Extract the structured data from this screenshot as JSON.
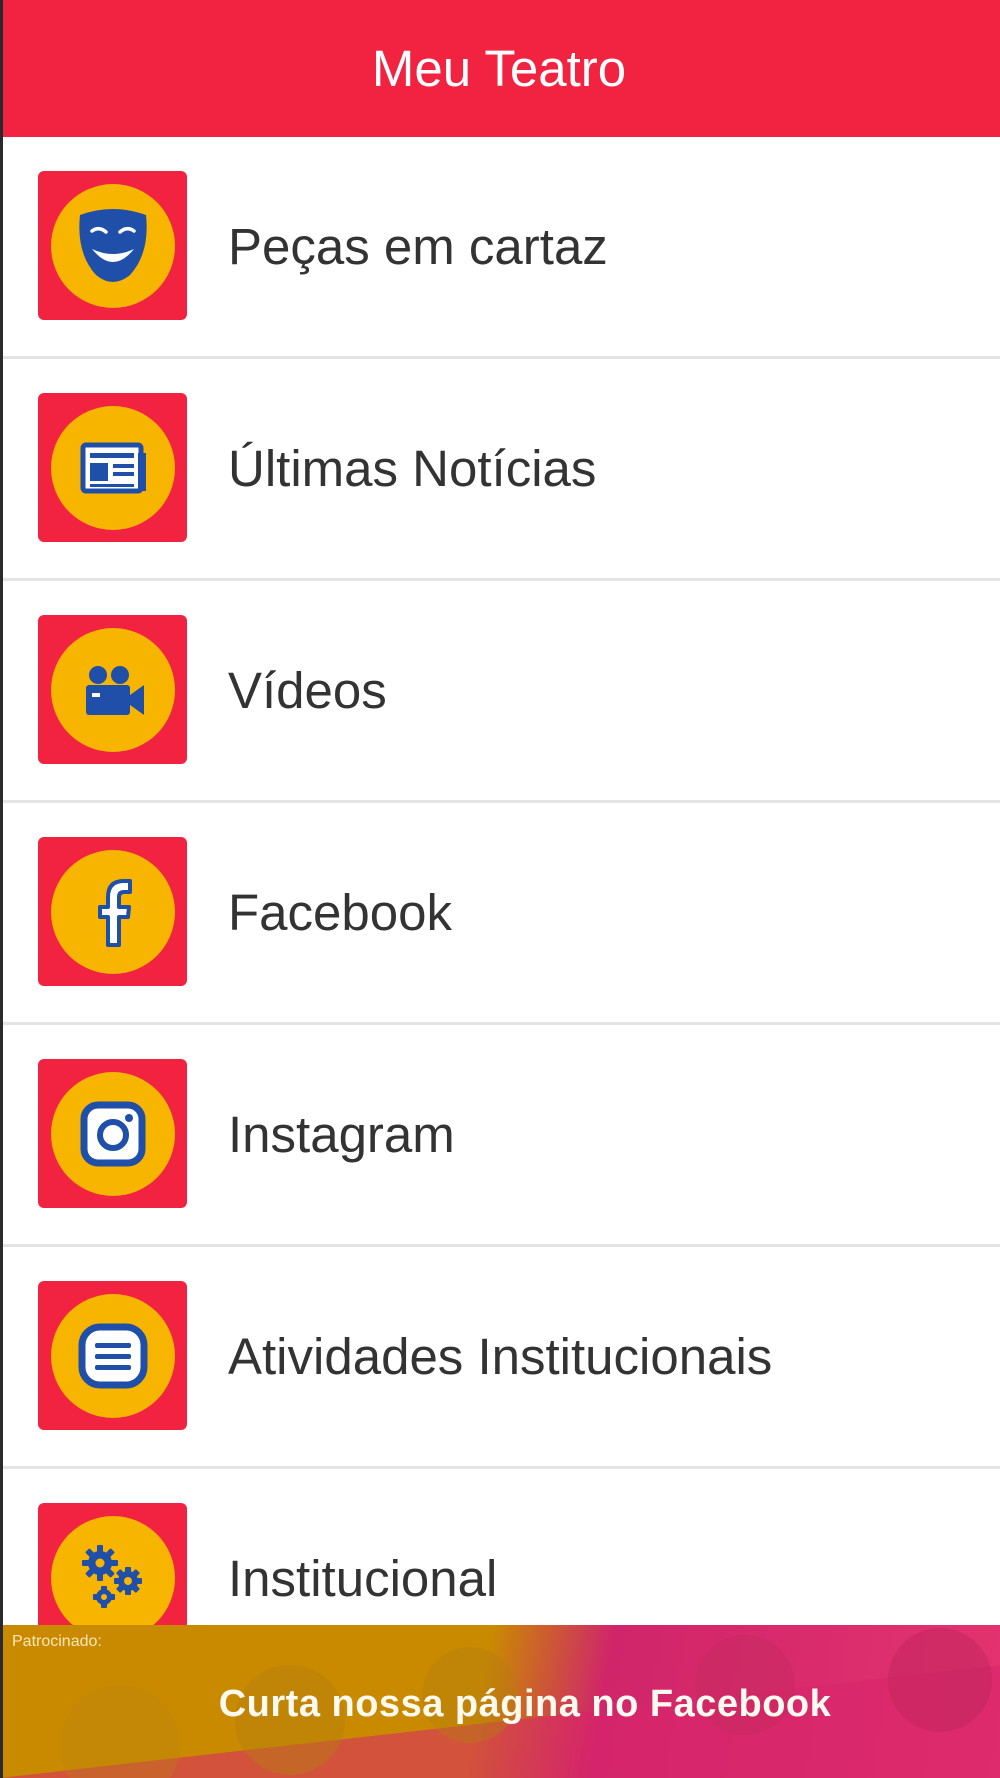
{
  "app": {
    "title": "Meu Teatro"
  },
  "menu": {
    "items": [
      {
        "label": "Peças em cartaz",
        "icon": "theater-mask-icon"
      },
      {
        "label": "Últimas Notícias",
        "icon": "newspaper-icon"
      },
      {
        "label": "Vídeos",
        "icon": "video-camera-icon"
      },
      {
        "label": "Facebook",
        "icon": "facebook-icon"
      },
      {
        "label": "Instagram",
        "icon": "instagram-icon"
      },
      {
        "label": "Atividades Institucionais",
        "icon": "list-icon"
      },
      {
        "label": "Institucional",
        "icon": "gears-icon"
      }
    ]
  },
  "banner": {
    "sponsored_label": "Patrocinado:",
    "cta": "Curta nossa página no Facebook"
  },
  "colors": {
    "accent": "#f12340",
    "icon_disc": "#f7b500",
    "icon_glyph": "#1f4fa8",
    "text": "#333333"
  }
}
